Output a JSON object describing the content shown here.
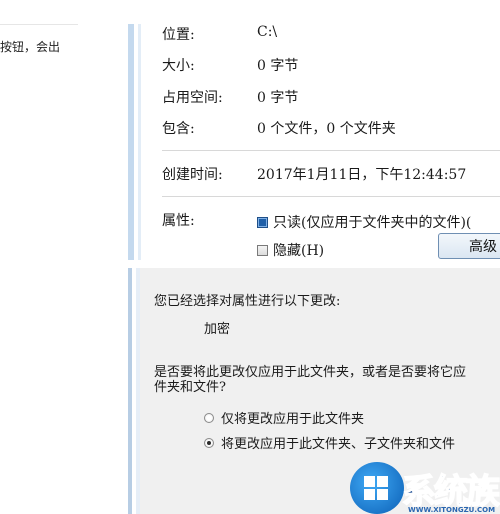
{
  "article": {
    "snippet": "按钮，会出"
  },
  "properties": {
    "location_label": "位置:",
    "location_value": "C:\\",
    "size_label": "大小:",
    "size_value": "0 字节",
    "size_on_disk_label": "占用空间:",
    "size_on_disk_value": "0 字节",
    "contains_label": "包含:",
    "contains_value": "0 个文件，0 个文件夹",
    "created_label": "创建时间:",
    "created_value": "2017年1月11日，下午12:44:57",
    "attributes_label": "属性:",
    "readonly_label": "只读(仅应用于文件夹中的文件)(",
    "readonly_checked": true,
    "hidden_label": "隐藏(H)",
    "hidden_checked": false,
    "advanced_button": "高级"
  },
  "confirm_dialog": {
    "intro": "您已经选择对属性进行以下更改:",
    "change": "加密",
    "question_line1": "是否要将此更改仅应用于此文件夹，或者是否要将它应",
    "question_line2": "件夹和文件?",
    "option_folder_only": "仅将更改应用于此文件夹",
    "option_all": "将更改应用于此文件夹、子文件夹和文件",
    "selected_option": "option_all"
  },
  "watermark": {
    "title": "系统族",
    "url": "WWW.XITONGZU.COM"
  },
  "colors": {
    "accent_blue": "#1f5fa8",
    "dialog_bg": "#f0f0f0",
    "frame_blue": "#c4d9ee",
    "watermark_blue": "#0a3e8a"
  }
}
